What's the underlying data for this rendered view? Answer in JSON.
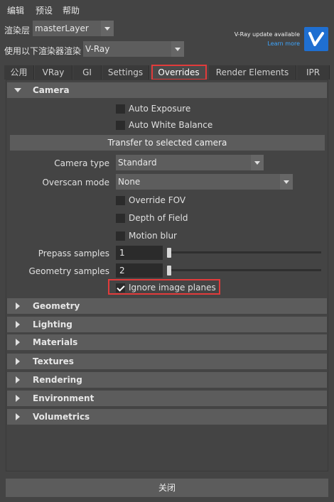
{
  "menubar": {
    "items": [
      "编辑",
      "预设",
      "帮助"
    ]
  },
  "render_layer": {
    "label": "渲染层",
    "value": "masterLayer"
  },
  "renderer": {
    "label": "使用以下渲染器渲染",
    "value": "V-Ray"
  },
  "promo": {
    "title": "V-Ray update available",
    "link": "Learn more",
    "logo_icon": "vray-logo-icon"
  },
  "tabs": [
    {
      "label": "公用"
    },
    {
      "label": "VRay"
    },
    {
      "label": "GI"
    },
    {
      "label": "Settings"
    },
    {
      "label": "Overrides",
      "active": true
    },
    {
      "label": "Render Elements"
    },
    {
      "label": "IPR"
    }
  ],
  "camera": {
    "section_label": "Camera",
    "auto_exposure": {
      "label": "Auto Exposure",
      "checked": false
    },
    "auto_white_balance": {
      "label": "Auto White Balance",
      "checked": false
    },
    "transfer_button": "Transfer to selected camera",
    "camera_type": {
      "label": "Camera type",
      "value": "Standard"
    },
    "overscan_mode": {
      "label": "Overscan mode",
      "value": "None"
    },
    "override_fov": {
      "label": "Override FOV",
      "checked": false
    },
    "depth_of_field": {
      "label": "Depth of Field",
      "checked": false
    },
    "motion_blur": {
      "label": "Motion blur",
      "checked": false
    },
    "prepass_samples": {
      "label": "Prepass samples",
      "value": "1",
      "slider_fraction": 0.0
    },
    "geometry_samples": {
      "label": "Geometry samples",
      "value": "2",
      "slider_fraction": 0.0
    },
    "ignore_image_planes": {
      "label": "Ignore image planes",
      "checked": true
    }
  },
  "collapsed_sections": [
    "Geometry",
    "Lighting",
    "Materials",
    "Textures",
    "Rendering",
    "Environment",
    "Volumetrics"
  ],
  "footer": {
    "close_label": "关闭"
  },
  "colors": {
    "accent_highlight": "#e23b3b",
    "link": "#3ea6ff",
    "vray_blue": "#1f6fd1"
  }
}
